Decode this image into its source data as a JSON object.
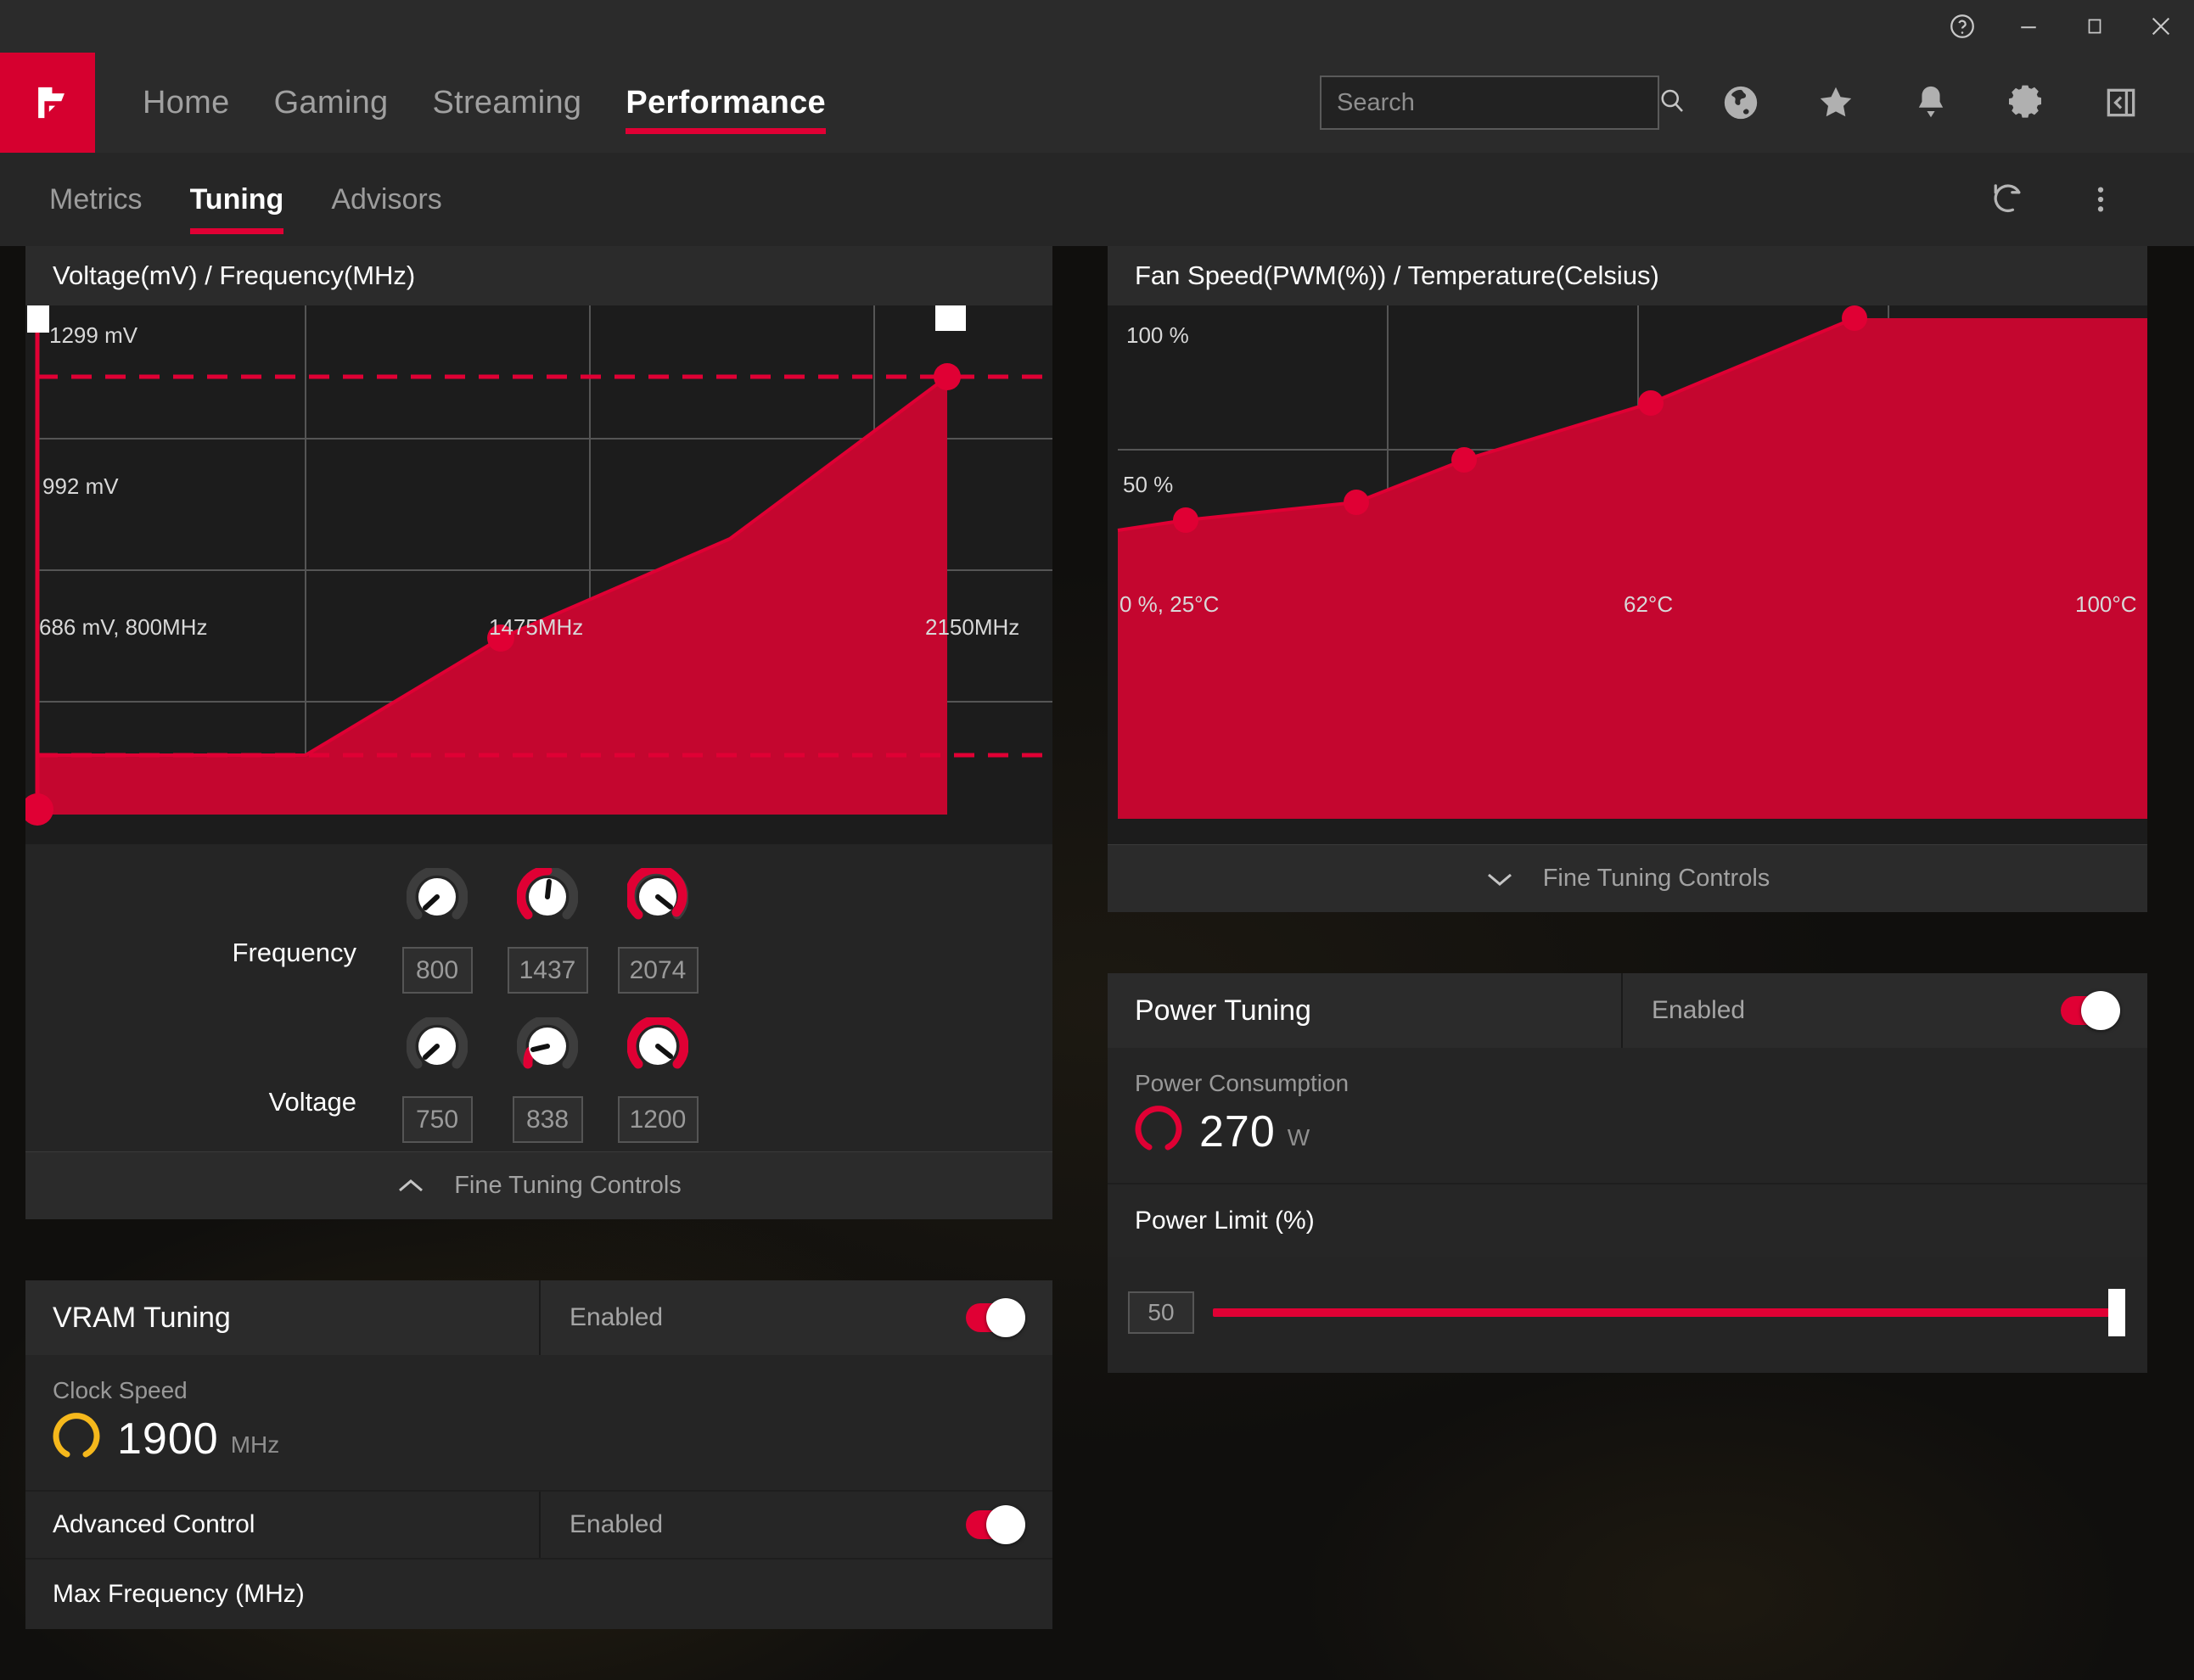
{
  "titlebar": {
    "buttons": [
      {
        "name": "help-icon",
        "label": "?"
      },
      {
        "name": "minimize-icon",
        "label": "–"
      },
      {
        "name": "maximize-icon",
        "label": "□"
      },
      {
        "name": "close-icon",
        "label": "✕"
      }
    ]
  },
  "mainnav": {
    "logo_alt": "AMD",
    "items": [
      {
        "label": "Home",
        "active": false
      },
      {
        "label": "Gaming",
        "active": false
      },
      {
        "label": "Streaming",
        "active": false
      },
      {
        "label": "Performance",
        "active": true
      }
    ],
    "search": {
      "placeholder": "Search",
      "value": ""
    },
    "icons": [
      "globe-icon",
      "star-icon",
      "bell-icon",
      "gear-icon",
      "collapse-panel-icon"
    ]
  },
  "subnav": {
    "items": [
      {
        "label": "Metrics",
        "active": false
      },
      {
        "label": "Tuning",
        "active": true
      },
      {
        "label": "Advisors",
        "active": false
      }
    ],
    "actions": [
      "reset-icon",
      "more-options-icon"
    ]
  },
  "gpu_tuning": {
    "chart_title": "Voltage(mV) / Frequency(MHz)",
    "fine_tuning_label": "Fine Tuning Controls",
    "frequency_label": "Frequency",
    "voltage_label": "Voltage",
    "frequency_values": [
      "800",
      "1437",
      "2074"
    ],
    "voltage_values": [
      "750",
      "838",
      "1200"
    ]
  },
  "vram_tuning": {
    "title": "VRAM Tuning",
    "enabled_label": "Enabled",
    "clock_speed_label": "Clock Speed",
    "clock_speed_value": "1900",
    "clock_speed_unit": "MHz",
    "advanced_control_label": "Advanced Control",
    "advanced_control_state": "Enabled",
    "max_frequency_label": "Max Frequency (MHz)"
  },
  "fan_tuning": {
    "chart_title": "Fan Speed(PWM(%)) / Temperature(Celsius)",
    "fine_tuning_label": "Fine Tuning Controls"
  },
  "power_tuning": {
    "title": "Power Tuning",
    "enabled_label": "Enabled",
    "consumption_label": "Power Consumption",
    "consumption_value": "270",
    "consumption_unit": "W",
    "power_limit_label": "Power Limit (%)",
    "power_limit_value": "50"
  },
  "colors": {
    "accent_red": "#e00034",
    "fill_red": "#c4062f",
    "vram_amber": "#f5b81c",
    "panel_bg": "#252525",
    "chart_bg": "#1c1c1c"
  },
  "chart_data": [
    {
      "type": "area",
      "id": "voltage-frequency-curve",
      "title": "Voltage(mV) / Frequency(MHz)",
      "xlabel": "Frequency (MHz)",
      "ylabel": "Voltage (mV)",
      "xlim": [
        800,
        2150
      ],
      "ylim": [
        686,
        1299
      ],
      "xticks": [
        800,
        1475,
        2150
      ],
      "xtick_labels": [
        "686 mV, 800MHz",
        "1475MHz",
        "2150MHz"
      ],
      "yticks": [
        992,
        1299
      ],
      "ytick_labels": [
        "992 mV",
        "1299 mV"
      ],
      "grid": true,
      "points": [
        {
          "x": 800,
          "y": 686,
          "label": "686 mV, 800MHz"
        },
        {
          "x": 1437,
          "y": 838
        },
        {
          "x": 2074,
          "y": 1200
        },
        {
          "x": 2150,
          "y": 1299
        }
      ],
      "reference_lines": [
        {
          "y": 1200,
          "style": "dashed",
          "color": "#e00034"
        },
        {
          "y": 750,
          "style": "dashed",
          "color": "#e00034"
        }
      ]
    },
    {
      "type": "area",
      "id": "fan-speed-curve",
      "title": "Fan Speed(PWM(%)) / Temperature(Celsius)",
      "xlabel": "Temperature (Celsius)",
      "ylabel": "Fan Speed (PWM %)",
      "xlim": [
        25,
        100
      ],
      "ylim": [
        0,
        100
      ],
      "xticks": [
        25,
        62,
        100
      ],
      "xtick_labels": [
        "0 %, 25°C",
        "62°C",
        "100°C"
      ],
      "yticks": [
        50,
        100
      ],
      "ytick_labels": [
        "50 %",
        "100 %"
      ],
      "grid": true,
      "points": [
        {
          "x": 25,
          "y": 0
        },
        {
          "x": 32,
          "y": 33
        },
        {
          "x": 48,
          "y": 41
        },
        {
          "x": 62,
          "y": 60
        },
        {
          "x": 78,
          "y": 87
        },
        {
          "x": 95,
          "y": 100
        }
      ]
    }
  ]
}
